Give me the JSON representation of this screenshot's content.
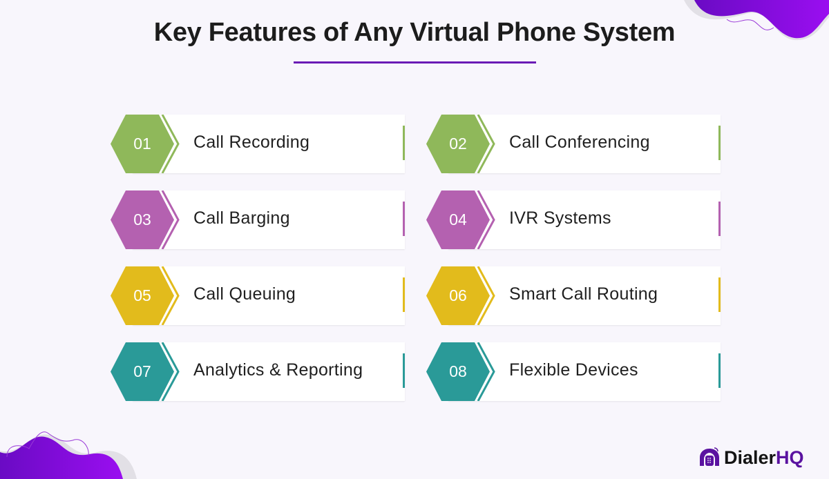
{
  "title": "Key Features of Any Virtual Phone System",
  "colors": {
    "accent": "#6a1bb5",
    "green": "#8fb85a",
    "magenta": "#b461b0",
    "yellow": "#e2bb1c",
    "teal": "#2a9a98"
  },
  "features": [
    {
      "number": "01",
      "label": "Call Recording",
      "color": "#8fb85a"
    },
    {
      "number": "02",
      "label": "Call Conferencing",
      "color": "#8fb85a"
    },
    {
      "number": "03",
      "label": "Call Barging",
      "color": "#b461b0"
    },
    {
      "number": "04",
      "label": "IVR Systems",
      "color": "#b461b0"
    },
    {
      "number": "05",
      "label": "Call Queuing",
      "color": "#e2bb1c"
    },
    {
      "number": "06",
      "label": "Smart Call Routing",
      "color": "#e2bb1c"
    },
    {
      "number": "07",
      "label": "Analytics & Reporting",
      "color": "#2a9a98"
    },
    {
      "number": "08",
      "label": "Flexible Devices",
      "color": "#2a9a98"
    }
  ],
  "logo": {
    "name": "Dialer",
    "suffix": "HQ",
    "icon": "headset-dialpad-icon"
  }
}
